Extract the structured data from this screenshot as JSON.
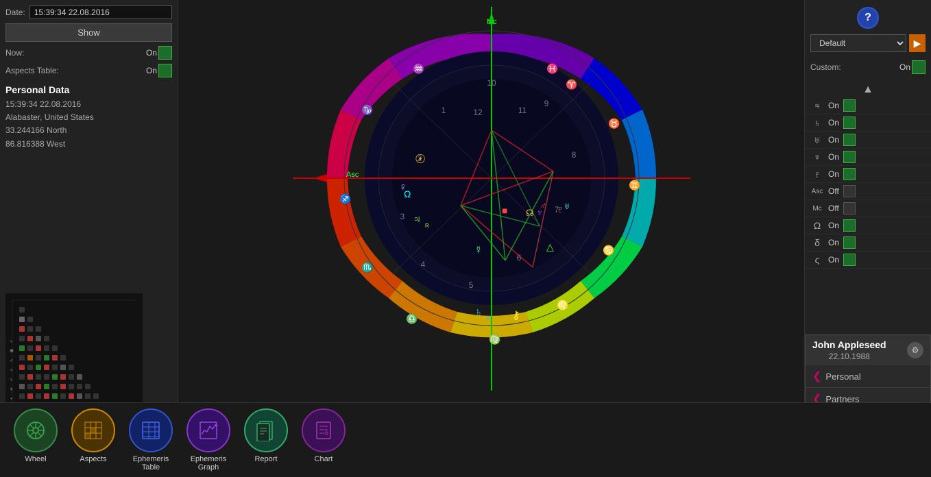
{
  "header": {
    "help_label": "?"
  },
  "left": {
    "date_label": "Date:",
    "date_value": "15:39:34 22.08.2016",
    "show_button": "Show",
    "now_label": "Now:",
    "now_value": "On",
    "aspects_table_label": "Aspects Table:",
    "aspects_table_value": "On",
    "personal_data_title": "Personal Data",
    "personal_data_lines": [
      "15:39:34 22.08.2016",
      "Alabaster, United States",
      "33.244166 North",
      "86.816388 West"
    ]
  },
  "right": {
    "default_label": "Default",
    "arrow_label": "▶",
    "custom_label": "Custom:",
    "custom_value": "On",
    "collapse_arrow": "▲",
    "planets": [
      {
        "symbol": "♃",
        "label": "",
        "value": "On",
        "state": "on"
      },
      {
        "symbol": "♄",
        "label": "",
        "value": "On",
        "state": "on"
      },
      {
        "symbol": "⛢",
        "label": "",
        "value": "On",
        "state": "on"
      },
      {
        "symbol": "♆",
        "label": "",
        "value": "On",
        "state": "on"
      },
      {
        "symbol": "♇",
        "label": "",
        "value": "On",
        "state": "on"
      },
      {
        "symbol": "Asc",
        "label": "",
        "value": "Off",
        "state": "off"
      },
      {
        "symbol": "Mc",
        "label": "",
        "value": "Off",
        "state": "off"
      },
      {
        "symbol": "Ω",
        "label": "",
        "value": "On",
        "state": "on"
      },
      {
        "symbol": "δ",
        "label": "",
        "value": "On",
        "state": "on"
      },
      {
        "symbol": "ς",
        "label": "",
        "value": "On",
        "state": "on"
      }
    ]
  },
  "bottom_nav": [
    {
      "label": "Wheel",
      "color": "#2a6632",
      "border": "#3a9a4a",
      "icon": "⊙"
    },
    {
      "label": "Aspects",
      "color": "#7a5500",
      "border": "#cc8800",
      "icon": "▦"
    },
    {
      "label": "Ephemeris\nTable",
      "color": "#223388",
      "border": "#3355cc",
      "icon": "⊞"
    },
    {
      "label": "Ephemeris\nGraph",
      "color": "#552288",
      "border": "#8833cc",
      "icon": "📈"
    },
    {
      "label": "Report",
      "color": "#226644",
      "border": "#33aa66",
      "icon": "⊡"
    },
    {
      "label": "Chart",
      "color": "#552266",
      "border": "#882299",
      "icon": "🗋"
    }
  ],
  "info_panel": {
    "name": "John Appleseed",
    "date": "22.10.1988",
    "personal_label": "Personal",
    "partners_label": "Partners"
  }
}
